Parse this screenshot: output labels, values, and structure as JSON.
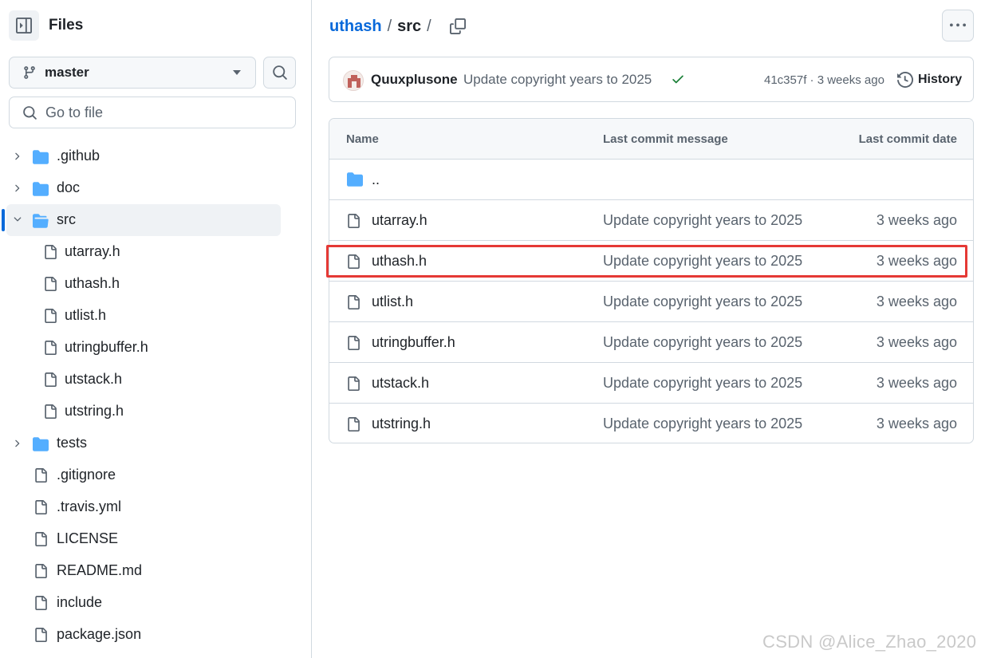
{
  "sidebar": {
    "title": "Files",
    "branch": "master",
    "goto_placeholder": "Go to file",
    "tree": [
      {
        "name": ".github",
        "type": "folder",
        "level": 0,
        "expanded": false
      },
      {
        "name": "doc",
        "type": "folder",
        "level": 0,
        "expanded": false
      },
      {
        "name": "src",
        "type": "folder",
        "level": 0,
        "expanded": true,
        "active": true
      },
      {
        "name": "utarray.h",
        "type": "file",
        "level": 1
      },
      {
        "name": "uthash.h",
        "type": "file",
        "level": 1
      },
      {
        "name": "utlist.h",
        "type": "file",
        "level": 1
      },
      {
        "name": "utringbuffer.h",
        "type": "file",
        "level": 1
      },
      {
        "name": "utstack.h",
        "type": "file",
        "level": 1
      },
      {
        "name": "utstring.h",
        "type": "file",
        "level": 1
      },
      {
        "name": "tests",
        "type": "folder",
        "level": 0,
        "expanded": false
      },
      {
        "name": ".gitignore",
        "type": "file",
        "level": 0
      },
      {
        "name": ".travis.yml",
        "type": "file",
        "level": 0
      },
      {
        "name": "LICENSE",
        "type": "file",
        "level": 0
      },
      {
        "name": "README.md",
        "type": "file",
        "level": 0
      },
      {
        "name": "include",
        "type": "file",
        "level": 0
      },
      {
        "name": "package.json",
        "type": "file",
        "level": 0
      }
    ]
  },
  "breadcrumb": {
    "repo": "uthash",
    "sep1": "/",
    "current": "src",
    "sep2": "/"
  },
  "commit": {
    "author": "Quuxplusone",
    "message": "Update copyright years to 2025",
    "meta": "41c357f · 3 weeks ago",
    "history_label": "History"
  },
  "table": {
    "headers": {
      "name": "Name",
      "message": "Last commit message",
      "date": "Last commit date"
    },
    "parent": "..",
    "rows": [
      {
        "name": "utarray.h",
        "message": "Update copyright years to 2025",
        "date": "3 weeks ago"
      },
      {
        "name": "uthash.h",
        "message": "Update copyright years to 2025",
        "date": "3 weeks ago",
        "highlighted": true
      },
      {
        "name": "utlist.h",
        "message": "Update copyright years to 2025",
        "date": "3 weeks ago"
      },
      {
        "name": "utringbuffer.h",
        "message": "Update copyright years to 2025",
        "date": "3 weeks ago"
      },
      {
        "name": "utstack.h",
        "message": "Update copyright years to 2025",
        "date": "3 weeks ago"
      },
      {
        "name": "utstring.h",
        "message": "Update copyright years to 2025",
        "date": "3 weeks ago"
      }
    ]
  },
  "colors": {
    "link": "#0969da",
    "folder": "#54aeff",
    "check": "#1a7f37",
    "highlight_border": "#e53935"
  },
  "watermark": "CSDN @Alice_Zhao_2020"
}
